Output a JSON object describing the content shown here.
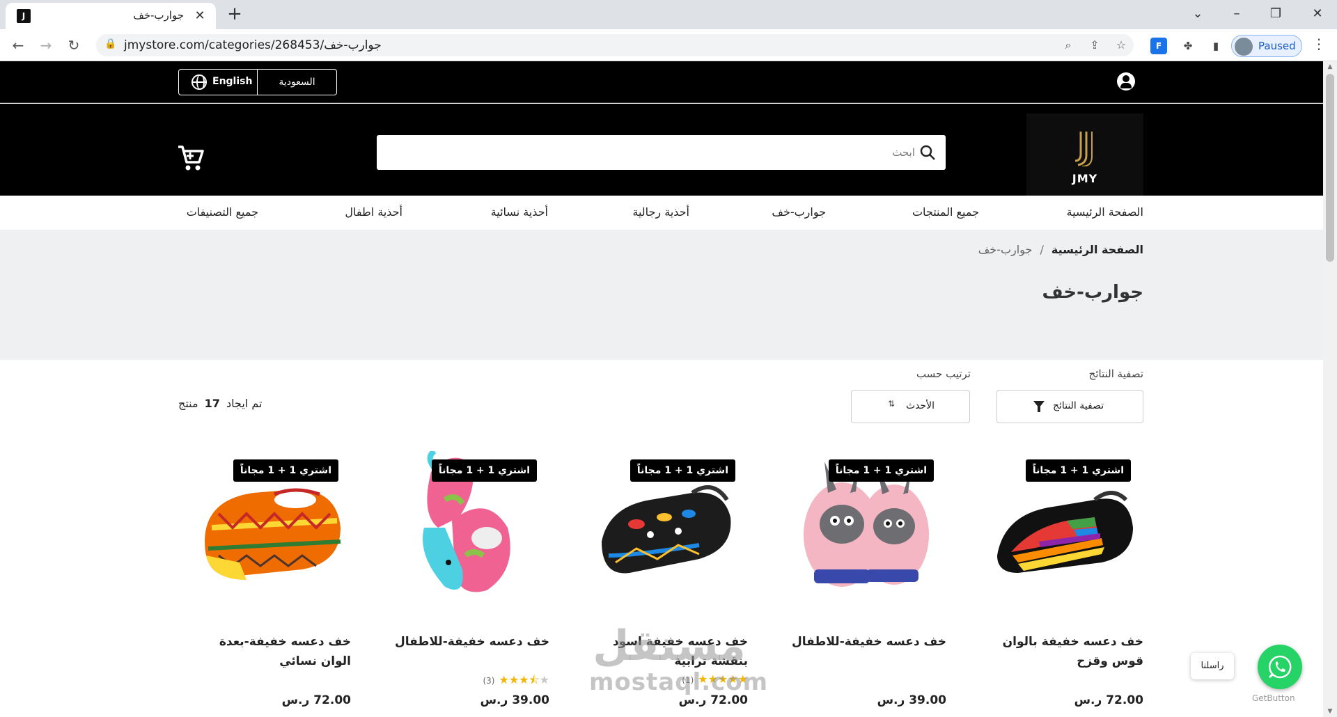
{
  "browser": {
    "tab_title": "جوارب-خف",
    "url": "jmystore.com/categories/268453/جوارب-خف",
    "profile_label": "Paused"
  },
  "topbar": {
    "lang_button": "English",
    "country_button": "السعودية"
  },
  "header": {
    "logo_text": "JMY",
    "search_placeholder": "ابحث"
  },
  "menu": [
    "الصفحة الرئيسية",
    "جميع المنتجات",
    "جوارب-خف",
    "أحذية رجالية",
    "أحذية نسائية",
    "أحذية اطفال",
    "جميع التصنيفات"
  ],
  "breadcrumb": {
    "home": "الصفحة الرئيسية",
    "separator": "/",
    "current": "جوارب-خف"
  },
  "page_title": "جوارب-خف",
  "controls": {
    "filter_label": "تصفية النتائج",
    "filter_button": "تصفية النتائج",
    "sort_label": "ترتيب حسب",
    "sort_value": "الأحدث",
    "count_prefix": "تم ايجاد",
    "count_value": "17",
    "count_suffix": "منتج"
  },
  "products": [
    {
      "badge": "اشتري 1 + 1 مجاناً",
      "name": "خف دعسه خفيفة بالوان قوس وقزح",
      "price": "72.00 ر.س",
      "image": "rainbow-water-shoe"
    },
    {
      "badge": "اشتري 1 + 1 مجاناً",
      "name": "خف دعسه خفيفة-للاطفال",
      "price": "39.00 ر.س",
      "image": "pink-bunny-kids-shoe"
    },
    {
      "badge": "اشتري 1 + 1 مجاناً",
      "name": "خف دعسه خفيفة اسود بنقشة ترابية",
      "price": "72.00 ر.س",
      "image": "black-tribal-shoe",
      "rating_count": "(1)",
      "rating_value": 5
    },
    {
      "badge": "اشتري 1 + 1 مجاناً",
      "name": "خف دعسه خفيفة-للاطفال",
      "price": "39.00 ر.س",
      "image": "pink-blue-whale-shoe",
      "rating_count": "(3)",
      "rating_value": 3.5
    },
    {
      "badge": "اشتري 1 + 1 مجاناً",
      "name": "خف دعسه خفيفة-بعدة الوان نسائي",
      "price": "72.00 ر.س",
      "image": "orange-aztec-shoe"
    }
  ],
  "watermark": {
    "arabic": "مستقل",
    "latin": "mostaql.com"
  },
  "whatsapp": {
    "tooltip": "راسلنا",
    "brand": "GetButton"
  },
  "colors": {
    "header_bg": "#000000",
    "logo_gold": "#c9a04a",
    "star": "#f4b400",
    "whatsapp": "#25d366"
  }
}
